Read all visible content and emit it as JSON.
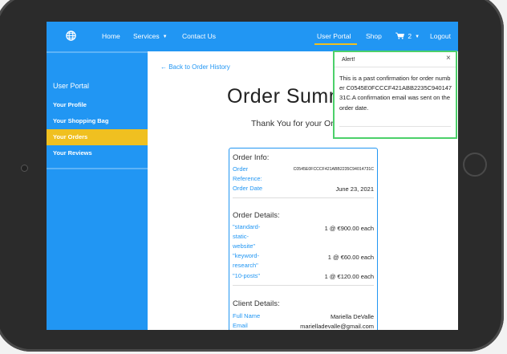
{
  "nav": {
    "home": "Home",
    "services": "Services",
    "contact": "Contact Us",
    "user_portal": "User Portal",
    "shop": "Shop",
    "cart_count": "2",
    "logout": "Logout"
  },
  "sidebar": {
    "title": "User Portal",
    "items": [
      {
        "label": "Your Profile"
      },
      {
        "label": "Your Shopping Bag"
      },
      {
        "label": "Your Orders"
      },
      {
        "label": "Your Reviews"
      }
    ]
  },
  "main": {
    "back_link": "← Back to Order History",
    "title": "Order Summary",
    "subtitle": "Thank You for your Order!"
  },
  "order_info": {
    "heading": "Order Info:",
    "reference_label": "Order Reference:",
    "reference_value": "C0545E0FCCCF421ABB2235C94014731C",
    "date_label": "Order Date",
    "date_value": "June 23, 2021"
  },
  "order_details": {
    "heading": "Order Details:",
    "items": [
      {
        "name": "\"standard-static-website\"",
        "qty_price": "1 @ €900.00 each"
      },
      {
        "name": "\"keyword-research\"",
        "qty_price": "1 @ €60.00 each"
      },
      {
        "name": "\"10-posts\"",
        "qty_price": "1 @ €120.00 each"
      }
    ]
  },
  "client_details": {
    "heading": "Client Details:",
    "name_label": "Full Name",
    "name_value": "Mariella DeValle",
    "email_label": "Email",
    "email_value": "marielladevalle@gmail.com"
  },
  "alert": {
    "title": "Alert!",
    "close": "×",
    "message": "This is a past confirmation for order number C0545E0FCCCF421ABB2235C94014731C.A confirmation email was sent on the order date."
  },
  "colors": {
    "primary": "#2196f3",
    "active": "#f0c020",
    "alert_border": "#4cd06a"
  }
}
